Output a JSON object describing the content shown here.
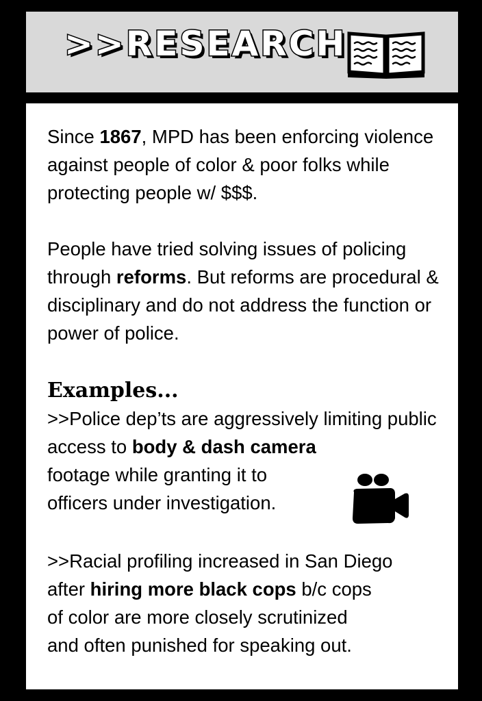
{
  "header": {
    "title": ">>RESEARCH",
    "icon": "open-book-icon"
  },
  "paragraphs": {
    "intro": {
      "before": "Since ",
      "bold": "1867",
      "after": ", MPD has been enforcing violence against people of color & poor folks while protecting people w/ $$$."
    },
    "reforms": {
      "before": "People have tried solving issues of policing through ",
      "bold": "reforms",
      "after": ". But reforms are procedural & disciplinary and do not address the function or power of police."
    }
  },
  "examples": {
    "heading": "Examples...",
    "items": [
      {
        "before": ">>Police dep’ts are aggressively limiting public access to ",
        "bold": "body & dash camera",
        "line3": "footage while granting it to",
        "line4": "officers under investigation.",
        "icon": "video-camera-icon"
      },
      {
        "line1": ">>Racial profiling increased in San Diego",
        "before": "after ",
        "bold": "hiring more black cops",
        "after": " b/c cops",
        "line3": "of color are more closely scrutinized",
        "line4": "and often punished for speaking out."
      }
    ]
  },
  "colors": {
    "border": "#000000",
    "header_bg": "#d9d9d9",
    "content_bg": "#ffffff",
    "text": "#000000"
  }
}
